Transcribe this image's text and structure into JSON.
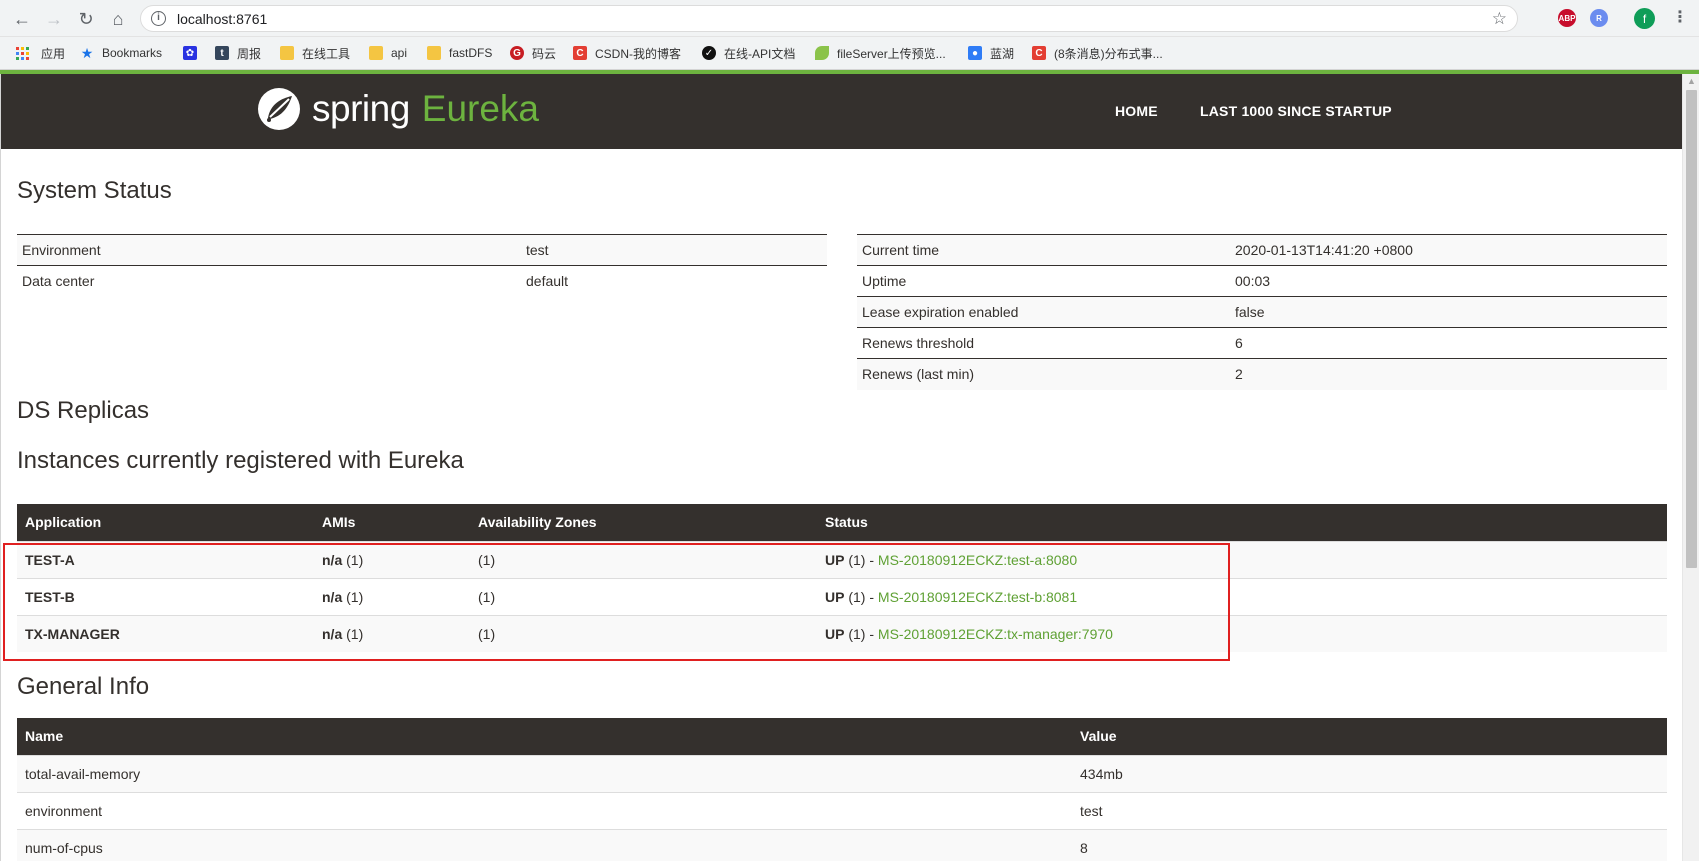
{
  "browser": {
    "url": "localhost:8761",
    "profile_initial": "f",
    "extensions": [
      {
        "name": "adblock-plus-icon",
        "label": "ABP",
        "color": "#c70d2c"
      },
      {
        "name": "extension-r-icon",
        "label": "R",
        "color": "#6b8cef"
      }
    ],
    "bookmarks": [
      {
        "label": "应用",
        "icon": "apps-icon"
      },
      {
        "label": "Bookmarks",
        "icon": "star-icon"
      },
      {
        "label": "",
        "icon": "baidu-icon"
      },
      {
        "label": "周报",
        "icon": "t-icon"
      },
      {
        "label": "在线工具",
        "icon": "folder-icon"
      },
      {
        "label": "api",
        "icon": "folder-icon"
      },
      {
        "label": "fastDFS",
        "icon": "folder-icon"
      },
      {
        "label": "码云",
        "icon": "gitee-icon"
      },
      {
        "label": "CSDN-我的博客",
        "icon": "csdn-icon"
      },
      {
        "label": "在线-API文档",
        "icon": "api-doc-icon"
      },
      {
        "label": "fileServer上传预览...",
        "icon": "leaf-icon"
      },
      {
        "label": "蓝湖",
        "icon": "lanhu-icon"
      },
      {
        "label": "(8条消息)分布式事...",
        "icon": "csdn-icon"
      }
    ]
  },
  "header": {
    "brand_spring": "spring",
    "brand_eureka": "Eureka",
    "nav": [
      "HOME",
      "LAST 1000 SINCE STARTUP"
    ]
  },
  "system_status": {
    "title": "System Status",
    "left": [
      {
        "key": "Environment",
        "value": "test"
      },
      {
        "key": "Data center",
        "value": "default"
      }
    ],
    "right": [
      {
        "key": "Current time",
        "value": "2020-01-13T14:41:20 +0800"
      },
      {
        "key": "Uptime",
        "value": "00:03"
      },
      {
        "key": "Lease expiration enabled",
        "value": "false"
      },
      {
        "key": "Renews threshold",
        "value": "6"
      },
      {
        "key": "Renews (last min)",
        "value": "2"
      }
    ]
  },
  "ds_replicas": {
    "title": "DS Replicas"
  },
  "instances": {
    "title": "Instances currently registered with Eureka",
    "columns": [
      "Application",
      "AMIs",
      "Availability Zones",
      "Status"
    ],
    "rows": [
      {
        "app": "TEST-A",
        "amis_bold": "n/a",
        "amis_count": "(1)",
        "zones": "(1)",
        "status_bold": "UP",
        "status_count": "(1) -",
        "link": "MS-20180912ECKZ:test-a:8080"
      },
      {
        "app": "TEST-B",
        "amis_bold": "n/a",
        "amis_count": "(1)",
        "zones": "(1)",
        "status_bold": "UP",
        "status_count": "(1) -",
        "link": "MS-20180912ECKZ:test-b:8081"
      },
      {
        "app": "TX-MANAGER",
        "amis_bold": "n/a",
        "amis_count": "(1)",
        "zones": "(1)",
        "status_bold": "UP",
        "status_count": "(1) -",
        "link": "MS-20180912ECKZ:tx-manager:7970"
      }
    ]
  },
  "general_info": {
    "title": "General Info",
    "columns": [
      "Name",
      "Value"
    ],
    "rows": [
      {
        "name": "total-avail-memory",
        "value": "434mb"
      },
      {
        "name": "environment",
        "value": "test"
      },
      {
        "name": "num-of-cpus",
        "value": "8"
      }
    ]
  },
  "colors": {
    "brand_green": "#6db33f",
    "nav_bg": "#34302d",
    "highlight": "#e02020"
  }
}
